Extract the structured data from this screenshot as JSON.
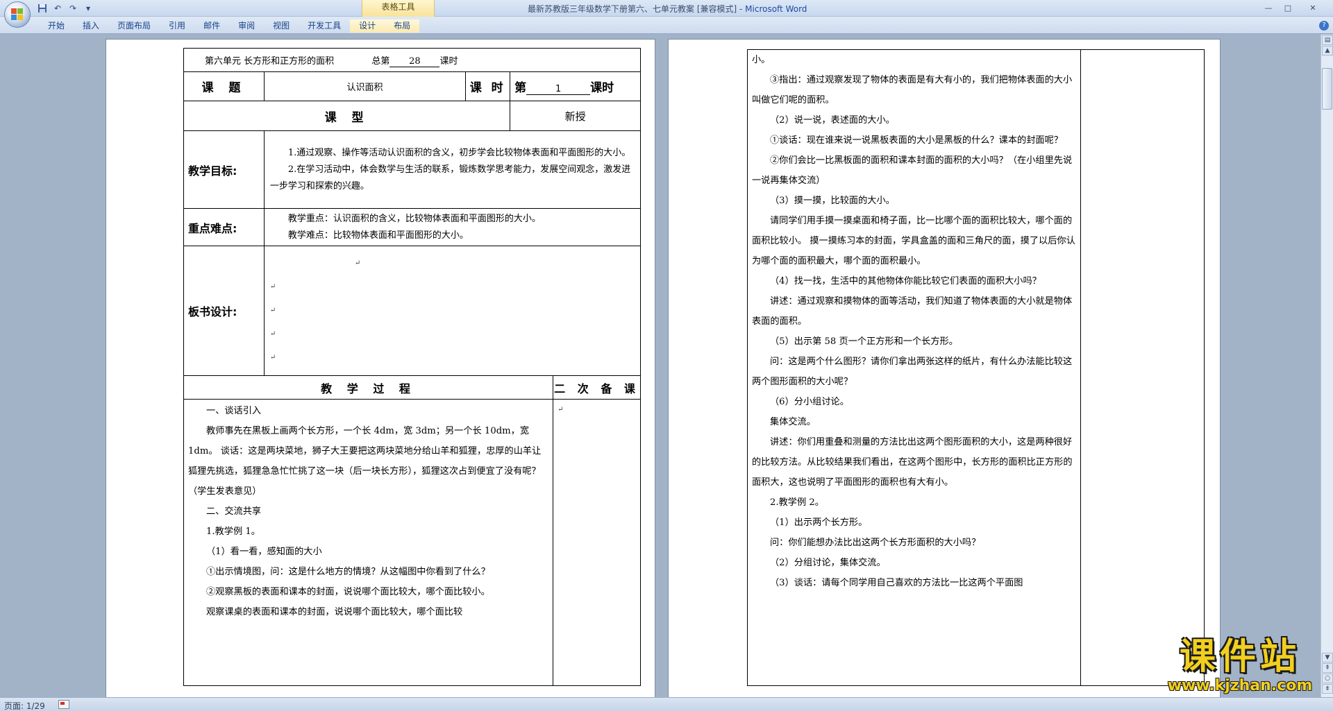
{
  "window": {
    "title_doc": "最新苏教版三年级数学下册第六、七单元教案 [兼容模式]",
    "title_sep": " - ",
    "title_app": "Microsoft Word",
    "context_tab_group": "表格工具",
    "controls": [
      "—",
      "□",
      "✕"
    ]
  },
  "quick_access": {
    "save": "save-icon",
    "undo": "↶",
    "redo": "↷",
    "customize": "▾"
  },
  "ribbon": {
    "tabs": [
      "开始",
      "插入",
      "页面布局",
      "引用",
      "邮件",
      "审阅",
      "视图",
      "开发工具"
    ],
    "context_tabs": [
      "设计",
      "布局"
    ],
    "help": "?"
  },
  "page1": {
    "header_unit": "第六单元  长方形和正方形的面积",
    "header_total_prefix": "总第",
    "header_total_num": "28",
    "header_total_suffix": "课时",
    "topic_label": "课  题",
    "topic_value": "认识面积",
    "period_label": "课 时",
    "period_prefix": "第",
    "period_num": "1",
    "period_suffix": "课时",
    "type_label": "课     型",
    "type_value": "新授",
    "goals_label": "教学目标:",
    "goals": [
      "1.通过观察、操作等活动认识面积的含义，初步学会比较物体表面和平面图形的大小。",
      "2.在学习活动中，体会数学与生活的联系，锻炼数学思考能力，发展空间观念，激发进一步学习和探索的兴趣。"
    ],
    "key_label": "重点难点:",
    "key_points": [
      "教学重点：认识面积的含义，比较物体表面和平面图形的大小。",
      "教学难点：比较物体表面和平面图形的大小。"
    ],
    "board_label": "板书设计:",
    "process_label": "教  学  过  程",
    "review_label": "二 次 备 课",
    "process": [
      {
        "text": "一、谈话引入",
        "style": "indent"
      },
      {
        "text": "教师事先在黑板上画两个长方形，一个长 4dm，宽 3dm；另一个长 10dm，宽 1dm。 谈话：这是两块菜地，狮子大王要把这两块菜地分给山羊和狐狸，忠厚的山羊让狐狸先挑选，狐狸急急忙忙挑了这一块（后一块长方形），狐狸这次占到便宜了没有呢？（学生发表意见）",
        "style": "indent"
      },
      {
        "text": "二、交流共享",
        "style": "indent"
      },
      {
        "text": "1.教学例 1。",
        "style": "indent"
      },
      {
        "text": "（1）看一看，感知面的大小",
        "style": "indent"
      },
      {
        "text": "①出示情境图，问：这是什么地方的情境？从这幅图中你看到了什么？",
        "style": "indent"
      },
      {
        "text": "②观察黑板的表面和课本的封面，说说哪个面比较大，哪个面比较小。",
        "style": "indent"
      },
      {
        "text": "观察课桌的表面和课本的封面，说说哪个面比较大，哪个面比较",
        "style": "indent"
      }
    ]
  },
  "page2": {
    "paragraphs": [
      {
        "text": "小。",
        "style": "plain"
      },
      {
        "text": "③指出：通过观察发现了物体的表面是有大有小的，我们把物体表面的大小叫做它们呢的面积。",
        "style": "indent"
      },
      {
        "text": "（2）说一说，表述面的大小。",
        "style": "indent"
      },
      {
        "text": "①谈话：现在谁来说一说黑板表面的大小是黑板的什么？课本的封面呢？",
        "style": "indent"
      },
      {
        "text": "②你们会比一比黑板面的面积和课本封面的面积的大小吗？（在小组里先说一说再集体交流）",
        "style": "indent"
      },
      {
        "text": "（3）摸一摸，比较面的大小。",
        "style": "indent"
      },
      {
        "text": "请同学们用手摸一摸桌面和椅子面，比一比哪个面的面积比较大，哪个面的面积比较小。 摸一摸练习本的封面，学具盒盖的面和三角尺的面，摸了以后你认为哪个面的面积最大，哪个面的面积最小。",
        "style": "indent"
      },
      {
        "text": "（4）找一找，生活中的其他物体你能比较它们表面的面积大小吗？",
        "style": "indent"
      },
      {
        "text": "讲述：通过观察和摸物体的面等活动，我们知道了物体表面的大小就是物体表面的面积。",
        "style": "indent"
      },
      {
        "text": "（5）出示第 58 页一个正方形和一个长方形。",
        "style": "indent"
      },
      {
        "text": "问：这是两个什么图形？请你们拿出两张这样的纸片，有什么办法能比较这两个图形面积的大小呢？",
        "style": "indent"
      },
      {
        "text": "（6）分小组讨论。",
        "style": "indent"
      },
      {
        "text": "集体交流。",
        "style": "indent"
      },
      {
        "text": "讲述：你们用重叠和测量的方法比出这两个图形面积的大小，这是两种很好的比较方法。从比较结果我们看出，在这两个图形中，长方形的面积比正方形的面积大，这也说明了平面图形的面积也有大有小。",
        "style": "indent"
      },
      {
        "text": "2.教学例 2。",
        "style": "indent"
      },
      {
        "text": "（1）出示两个长方形。",
        "style": "indent"
      },
      {
        "text": "问：你们能想办法比出这两个长方形面积的大小吗？",
        "style": "indent"
      },
      {
        "text": "（2）分组讨论，集体交流。",
        "style": "indent"
      },
      {
        "text": "（3）谈话：请每个同学用自己喜欢的方法比一比这两个平面图",
        "style": "indent"
      }
    ]
  },
  "statusbar": {
    "page": "页面: 1/29"
  },
  "watermark": {
    "title": "课件站",
    "url": "www.kjzhan.com"
  },
  "colors": {
    "ribbon_text": "#15428b",
    "workspace": "#a3b3c7",
    "watermark": "#f2cf1e"
  }
}
